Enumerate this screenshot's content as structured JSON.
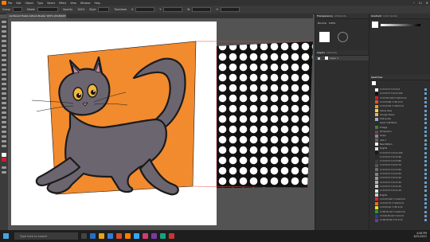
{
  "app": {
    "menu": [
      "File",
      "Edit",
      "Object",
      "Type",
      "Select",
      "Effect",
      "View",
      "Window",
      "Help"
    ],
    "window_controls": [
      "–",
      "☐",
      "✕"
    ],
    "doc_tab": "cardboard fiesta A-Book-Buster 200% (RGB/GPU Preview)"
  },
  "control_bar": {
    "labels": [
      "Group",
      "Stroke",
      "Opacity",
      "100%",
      "Style",
      "Transform",
      "X",
      "Y",
      "W",
      "H"
    ]
  },
  "layers_panel": {
    "tabs": [
      "Transparency",
      "Artboards"
    ],
    "tabs2": [
      "Layers",
      "Libraries"
    ],
    "layer_name": "Layer 1",
    "mode": "Normal",
    "opacity": "100%"
  },
  "properties_panel": {
    "tabs": [
      "Gradient",
      "Color Guide"
    ],
    "swatches_title": "Swatches",
    "swatches": [
      {
        "name": "C=0 M=0 Y=0 K=0",
        "color": "#ffffff"
      },
      {
        "name": "C=0 M=0 Y=0 K=100",
        "color": "#111111"
      },
      {
        "name": "C=15 M=100 Y=90 K=10",
        "color": "#c8202a"
      },
      {
        "name": "C=0 M=80 Y=95 K=0",
        "color": "#e45327"
      },
      {
        "name": "C=0 M=50 Y=100 K=0",
        "color": "#f39a1e"
      },
      {
        "name": "Yellow Glow",
        "color": "#f6d64e"
      },
      {
        "name": "Orange Yellow",
        "color": "#f3b540"
      },
      {
        "name": "Fading Sky",
        "color": "#8fb4d8"
      },
      {
        "name": "Super Soft Black",
        "color": "#2b2b2b"
      },
      {
        "name": "Foliage",
        "color": "#4a7a3a"
      },
      {
        "name": "Pompadour",
        "color": "#7a3a6a"
      },
      {
        "name": "Grays",
        "color": "#888888"
      },
      {
        "name": "cats 1",
        "color": "#6b6570"
      },
      {
        "name": "New Pattern",
        "color": "#ffffff"
      },
      {
        "name": "Brights",
        "color": "#dddddd"
      },
      {
        "name": "C=0 M=0 Y=0 K=100",
        "color": "#1a1a1a"
      },
      {
        "name": "C=0 M=0 Y=0 K=90",
        "color": "#2a2a2a"
      },
      {
        "name": "C=0 M=0 Y=0 K=80",
        "color": "#3d3d3d"
      },
      {
        "name": "C=0 M=0 Y=0 K=70",
        "color": "#555555"
      },
      {
        "name": "C=0 M=0 Y=0 K=60",
        "color": "#6b6b6b"
      },
      {
        "name": "C=0 M=0 Y=0 K=50",
        "color": "#808080"
      },
      {
        "name": "C=0 M=0 Y=0 K=40",
        "color": "#999999"
      },
      {
        "name": "C=0 M=0 Y=0 K=30",
        "color": "#b3b3b3"
      },
      {
        "name": "C=0 M=0 Y=0 K=20",
        "color": "#cccccc"
      },
      {
        "name": "C=0 M=0 Y=0 K=10",
        "color": "#e6e6e6"
      },
      {
        "name": "Brights",
        "color": "#cccccc"
      },
      {
        "name": "C=0 M=100 Y=100 K=0",
        "color": "#e8202a"
      },
      {
        "name": "C=0 M=75 Y=100 K=0",
        "color": "#ec6a22"
      },
      {
        "name": "C=0 M=10 Y=95 K=0",
        "color": "#f7dd12"
      },
      {
        "name": "C=85 M=10 Y=100 K=0",
        "color": "#1f9a45"
      },
      {
        "name": "C=100 M=90 Y=0 K=0",
        "color": "#2a3d96"
      },
      {
        "name": "C=60 M=90 Y=0 K=0",
        "color": "#6a3a96"
      }
    ]
  },
  "taskbar": {
    "search_placeholder": "Type here to search",
    "time": "4:08 PM",
    "date": "6/21/2021"
  },
  "colors": {
    "orange": "#f28a2e",
    "cat_body": "#6b6570",
    "outline": "#1b1b1b"
  }
}
